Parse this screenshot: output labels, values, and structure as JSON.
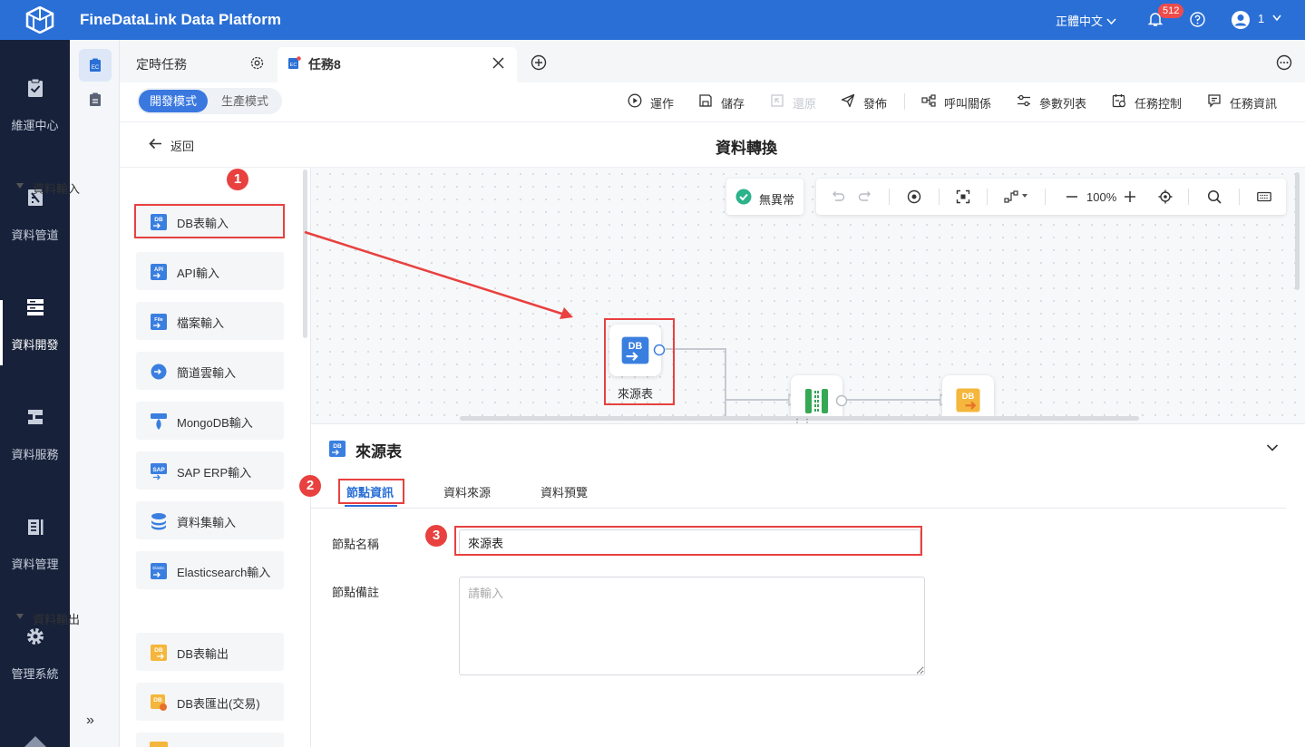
{
  "app": {
    "title": "FineDataLink Data Platform",
    "language": "正體中文",
    "notifications": "512",
    "username": "1"
  },
  "nav": {
    "items": [
      {
        "label": "維運中心",
        "icon": "clipboard-check-icon"
      },
      {
        "label": "資料管道",
        "icon": "pipeline-icon"
      },
      {
        "label": "資料開發",
        "icon": "dev-server-icon"
      },
      {
        "label": "資料服務",
        "icon": "service-icon"
      },
      {
        "label": "資料管理",
        "icon": "data-manage-icon"
      },
      {
        "label": "管理系統",
        "icon": "gear-icon"
      }
    ],
    "active": "資料開發"
  },
  "tabs": {
    "scheduled": "定時任務",
    "task": "任務8"
  },
  "toolbar": {
    "dev_mode": "開發模式",
    "prod_mode": "生產模式",
    "run": "運作",
    "save": "儲存",
    "restore": "還原",
    "publish": "發佈",
    "call_relation": "呼叫關係",
    "params": "參數列表",
    "task_control": "任務控制",
    "task_info": "任務資訊"
  },
  "header": {
    "back": "返回",
    "title": "資料轉換"
  },
  "components": {
    "input_group": "資料輸入",
    "inputs": [
      "DB表輸入",
      "API輸入",
      "檔案輸入",
      "簡道雲輸入",
      "MongoDB輸入",
      "SAP ERP輸入",
      "資料集輸入",
      "Elasticsearch輸入"
    ],
    "output_group": "資料輸出",
    "outputs": [
      "DB表輸出",
      "DB表匯出(交易)"
    ]
  },
  "canvas": {
    "status": "無異常",
    "zoom": "100%",
    "node_label": "來源表"
  },
  "drawer": {
    "title": "來源表",
    "tabs": [
      "節點資訊",
      "資料來源",
      "資料預覽"
    ],
    "name_label": "節點名稱",
    "name_value": "來源表",
    "note_label": "節點備註",
    "note_placeholder": "請輸入"
  },
  "annotations": [
    "1",
    "2",
    "3"
  ],
  "colors": {
    "brand": "#2a6fd6",
    "nav_bg": "#17213a",
    "highlight": "#e8413f"
  }
}
